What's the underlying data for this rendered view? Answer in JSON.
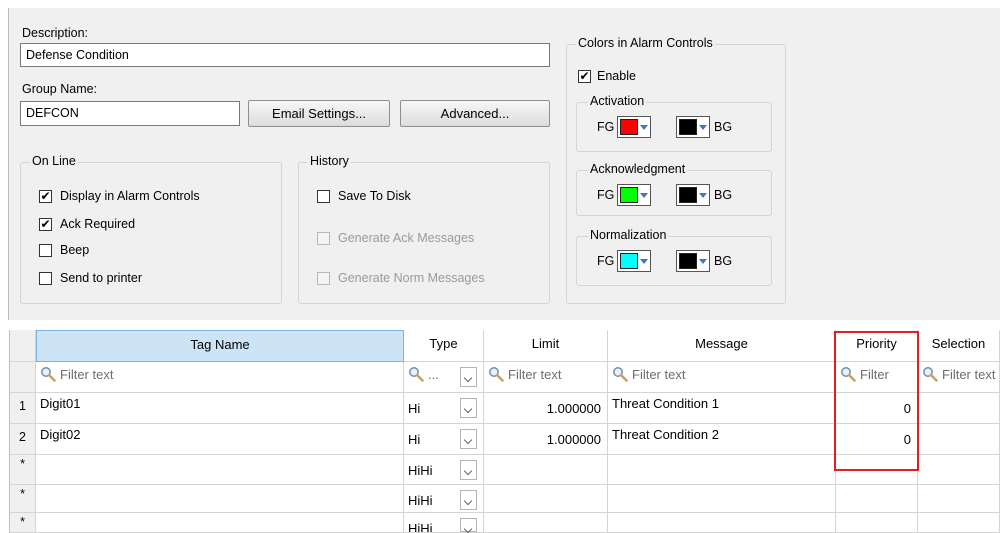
{
  "description": {
    "label": "Description:",
    "value": "Defense Condition"
  },
  "group_name": {
    "label": "Group Name:",
    "value": "DEFCON"
  },
  "buttons": {
    "email": "Email Settings...",
    "advanced": "Advanced..."
  },
  "online": {
    "title": "On Line",
    "items": [
      {
        "label": "Display in Alarm Controls",
        "checked": true
      },
      {
        "label": "Ack Required",
        "checked": true
      },
      {
        "label": "Beep",
        "checked": false
      },
      {
        "label": "Send to printer",
        "checked": false
      }
    ]
  },
  "history": {
    "title": "History",
    "items": [
      {
        "label": "Save To Disk",
        "checked": false,
        "enabled": true
      },
      {
        "label": "Generate Ack Messages",
        "checked": false,
        "enabled": false
      },
      {
        "label": "Generate Norm Messages",
        "checked": false,
        "enabled": false
      }
    ]
  },
  "colors": {
    "title": "Colors in Alarm Controls",
    "enable_label": "Enable",
    "enable_checked": true,
    "fg_label": "FG",
    "bg_label": "BG",
    "groups": [
      {
        "title": "Activation",
        "fg": "#ff0000",
        "bg": "#000000"
      },
      {
        "title": "Acknowledgment",
        "fg": "#00ff00",
        "bg": "#000000"
      },
      {
        "title": "Normalization",
        "fg": "#00ffff",
        "bg": "#000000"
      }
    ]
  },
  "grid": {
    "columns": [
      "Tag Name",
      "Type",
      "Limit",
      "Message",
      "Priority",
      "Selection"
    ],
    "filters": {
      "tag": "Filter text",
      "type": "...",
      "limit": "Filter text",
      "message": "Filter text",
      "priority": "Filter",
      "selection": "Filter text"
    },
    "rows": [
      {
        "row": "1",
        "tag": "Digit01",
        "type": "Hi",
        "limit": "1.000000",
        "message": "Threat Condition 1",
        "priority": "0"
      },
      {
        "row": "2",
        "tag": "Digit02",
        "type": "Hi",
        "limit": "1.000000",
        "message": "Threat Condition 2",
        "priority": "0"
      },
      {
        "row": "*",
        "tag": "",
        "type": "HiHi",
        "limit": "",
        "message": "",
        "priority": ""
      },
      {
        "row": "*",
        "tag": "",
        "type": "HiHi",
        "limit": "",
        "message": "",
        "priority": ""
      },
      {
        "row": "*",
        "tag": "",
        "type": "HiHi",
        "limit": "",
        "message": "",
        "priority": ""
      }
    ],
    "highlight_color": "#e02020"
  }
}
